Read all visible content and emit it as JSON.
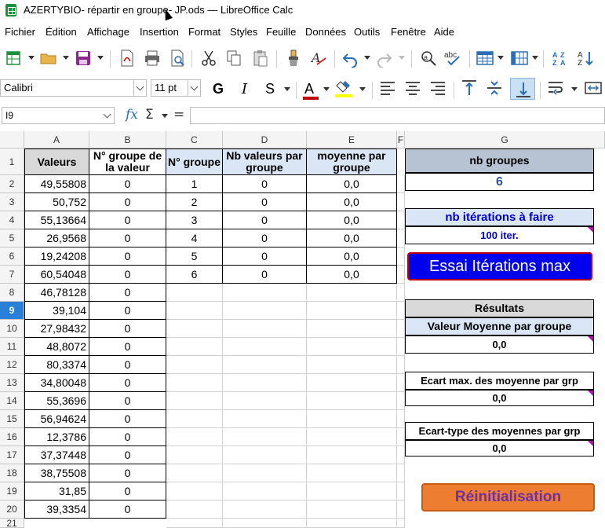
{
  "window": {
    "title": "AZERTYBIO- répartir en groupe- JP.ods — LibreOffice Calc"
  },
  "menu": [
    "Fichier",
    "Édition",
    "Affichage",
    "Insertion",
    "Format",
    "Styles",
    "Feuille",
    "Données",
    "Outils",
    "Fenêtre",
    "Aide"
  ],
  "format_bar": {
    "font_name": "Calibri",
    "font_size": "11 pt",
    "bold": "G",
    "italic": "I",
    "shadow": "S",
    "font_color": "A"
  },
  "formula_bar": {
    "cell_ref": "I9",
    "fx": "fx",
    "sum": "Σ",
    "equals": "=",
    "content": ""
  },
  "columns": [
    "A",
    "B",
    "C",
    "D",
    "E",
    "F",
    "G"
  ],
  "rows": [
    "1",
    "2",
    "3",
    "4",
    "5",
    "6",
    "7",
    "8",
    "9",
    "10",
    "11",
    "12",
    "13",
    "14",
    "15",
    "16",
    "17",
    "18",
    "19",
    "20",
    "21"
  ],
  "selected_row": "9",
  "headers": {
    "a1": "Valeurs",
    "b1": "N° groupe de la valeur",
    "c1": "N° groupe",
    "d1": "Nb valeurs par groupe",
    "e1": "moyenne par groupe"
  },
  "values": [
    "49,55808",
    "50,752",
    "55,13664",
    "26,9568",
    "19,24208",
    "60,54048",
    "46,78128",
    "39,104",
    "27,98432",
    "48,8072",
    "80,3374",
    "34,80048",
    "55,3696",
    "56,94624",
    "12,3786",
    "37,37448",
    "38,75508",
    "31,85",
    "39,3354"
  ],
  "group_of_value": [
    "0",
    "0",
    "0",
    "0",
    "0",
    "0",
    "0",
    "0",
    "0",
    "0",
    "0",
    "0",
    "0",
    "0",
    "0",
    "0",
    "0",
    "0",
    "0"
  ],
  "groups": [
    {
      "n": "1",
      "count": "0",
      "mean": "0,0"
    },
    {
      "n": "2",
      "count": "0",
      "mean": "0,0"
    },
    {
      "n": "3",
      "count": "0",
      "mean": "0,0"
    },
    {
      "n": "4",
      "count": "0",
      "mean": "0,0"
    },
    {
      "n": "5",
      "count": "0",
      "mean": "0,0"
    },
    {
      "n": "6",
      "count": "0",
      "mean": "0,0"
    }
  ],
  "panel": {
    "nb_groupes_label": "nb groupes",
    "nb_groupes_value": "6",
    "iterations_label": "nb itérations à faire",
    "iterations_value": "100 iter.",
    "run_button": "Essai Itérations max",
    "results_label": "Résultats",
    "mean_label": "Valeur Moyenne par groupe",
    "mean_value": "0,0",
    "ecart_label": "Ecart max. des moyenne par grp",
    "ecart_value": "0,0",
    "stddev_label": "Ecart-type des moyennes par grp",
    "stddev_value": "0,0",
    "reset_button": "Réinitialisation"
  },
  "colors": {
    "header_gray": "#d9d9d9",
    "group_blue": "#dae6f5",
    "panel_slate": "#b7c2d3",
    "run_button_blue": "#0000ee",
    "reset_button_orange": "#ed7d31",
    "reset_text": "#7030a0",
    "selection_blue": "#2a7fd6"
  },
  "icons": [
    "new-spreadsheet-icon",
    "open-folder-icon",
    "save-icon",
    "export-pdf-icon",
    "print-icon",
    "print-preview-icon",
    "cut-icon",
    "copy-icon",
    "paste-icon",
    "clone-formatting-icon",
    "clear-formatting-icon",
    "undo-icon",
    "redo-icon",
    "find-replace-icon",
    "spelling-icon",
    "row-icon",
    "column-icon",
    "sort-icon",
    "sort-ascending-icon"
  ]
}
